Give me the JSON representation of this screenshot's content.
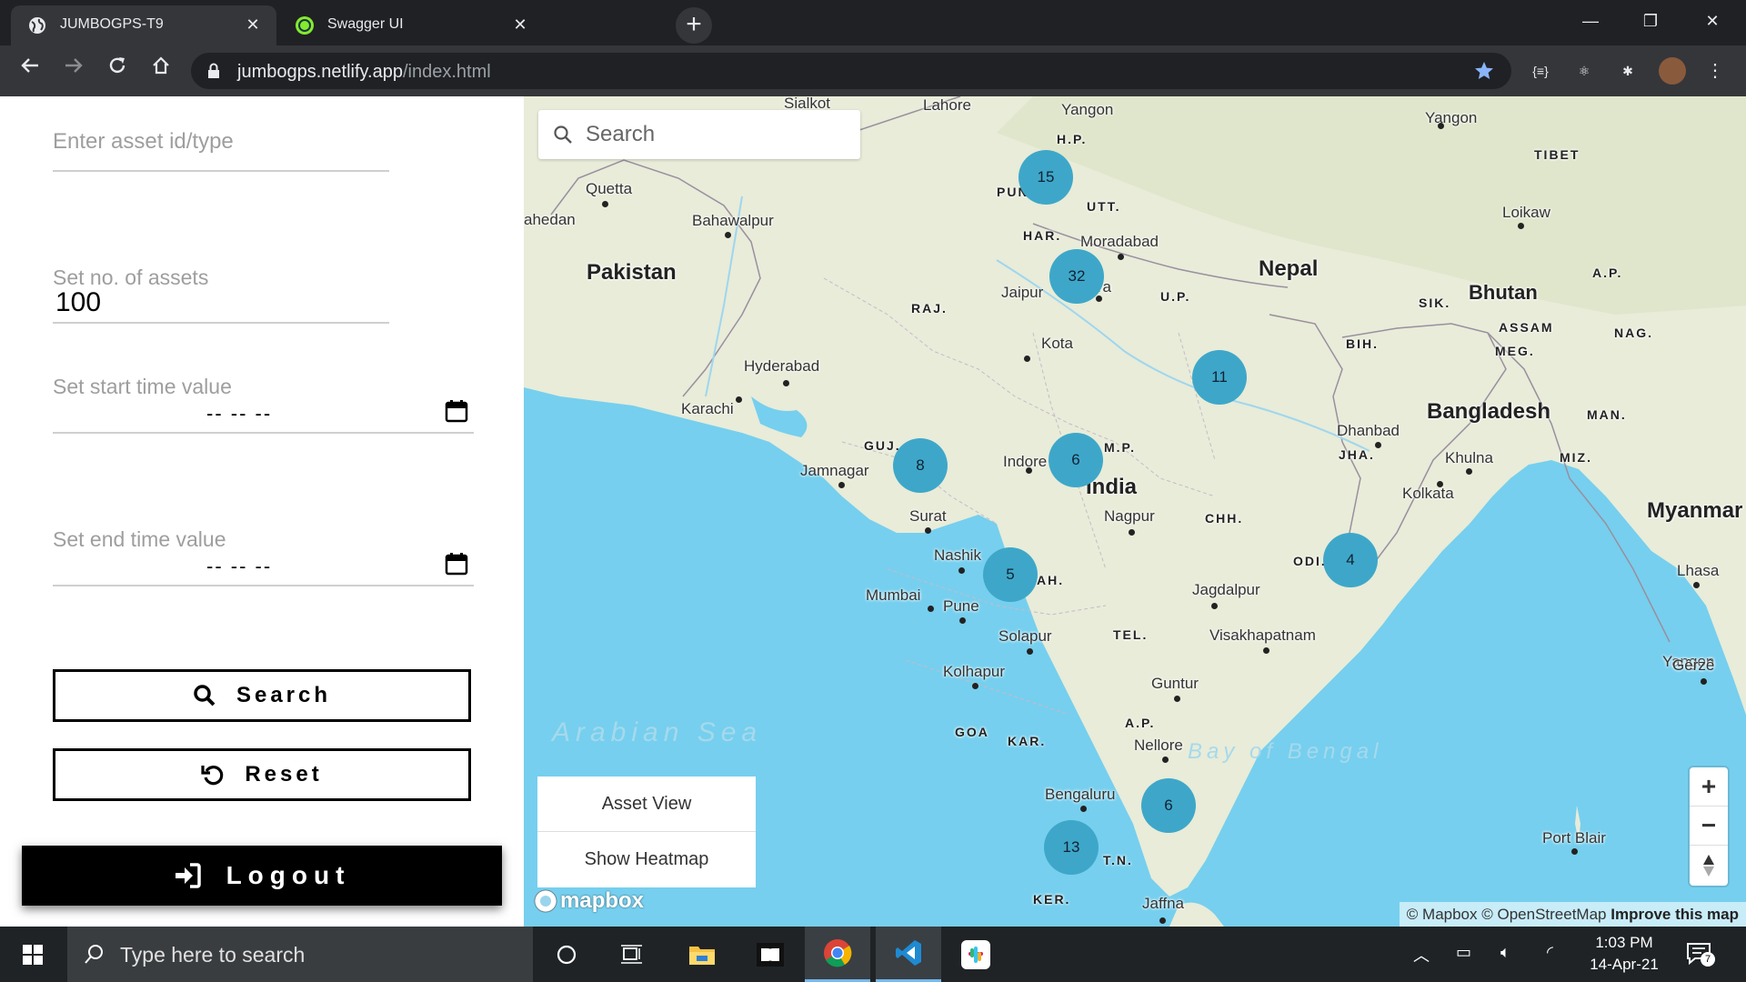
{
  "browser": {
    "tabs": [
      {
        "title": "JUMBOGPS-T9",
        "icon": "globe-icon",
        "active": true
      },
      {
        "title": "Swagger UI",
        "icon": "swagger-icon",
        "active": false
      }
    ],
    "url_host": "jumbogps.netlify.app",
    "url_path": "/index.html"
  },
  "form": {
    "asset_placeholder": "Enter asset id/type",
    "count_label": "Set no. of assets",
    "count_value": "100",
    "start_label": "Set start time value",
    "start_mask": "-- -- --",
    "end_label": "Set end time value",
    "end_mask": "-- -- --",
    "search_label": "Search",
    "reset_label": "Reset",
    "logout_label": "Logout"
  },
  "map": {
    "search_placeholder": "Search",
    "menu": [
      "Asset View",
      "Show Heatmap"
    ],
    "logo": "mapbox",
    "attribution_1": "© Mapbox © OpenStreetMap",
    "attribution_2": "Improve this map",
    "countries": [
      "Pakistan",
      "Nepal",
      "Bhutan",
      "Bangladesh",
      "India",
      "Myanmar (Burma)"
    ],
    "cities": [
      "Sialkot",
      "Lahore",
      "Quetta",
      "Bahawalpur",
      "Moradabad",
      "Agra",
      "Jaipur",
      "Kota",
      "Hyderabad",
      "Karachi",
      "Jamnagar",
      "Indore",
      "Nagpur",
      "Surat",
      "Nashik",
      "Mumbai",
      "Pune",
      "Solapur",
      "Kolhapur",
      "Bengaluru",
      "Nellore",
      "Guntur",
      "Visakhapatnam",
      "Jagdalpur",
      "Dhanbad",
      "Kolkata",
      "Khulna",
      "Lhasa",
      "Gêrzê",
      "Loikaw",
      "Yangon",
      "Port Blair",
      "Jaffna",
      "ahedan"
    ],
    "states": [
      "H.P.",
      "PUN",
      "UTT.",
      "HAR.",
      "RAJ.",
      "U.P.",
      "SIK.",
      "A.P.",
      "ASSAM",
      "NAG.",
      "MEG.",
      "BIH.",
      "MAN.",
      "MIZ.",
      "JHA.",
      "GUJ.",
      "M.P.",
      "CHH.",
      "ODI.",
      "AH.",
      "TEL.",
      "GOA",
      "KAR.",
      "A.P.",
      "T.N.",
      "KER.",
      "TIBET"
    ],
    "seas": [
      "Arabian Sea",
      "Bay of Bengal"
    ],
    "clusters": [
      15,
      32,
      11,
      8,
      6,
      5,
      4,
      6,
      13
    ],
    "zoom_buttons": [
      "+",
      "−",
      "compass"
    ]
  },
  "taskbar": {
    "search_placeholder": "Type here to search",
    "time": "1:03 PM",
    "date": "14-Apr-21",
    "notifications": "7"
  },
  "colors": {
    "water": "#76cfee",
    "land": "#e8ecd9",
    "cluster": "#3ea7c9",
    "chrome_dark": "#202124"
  }
}
